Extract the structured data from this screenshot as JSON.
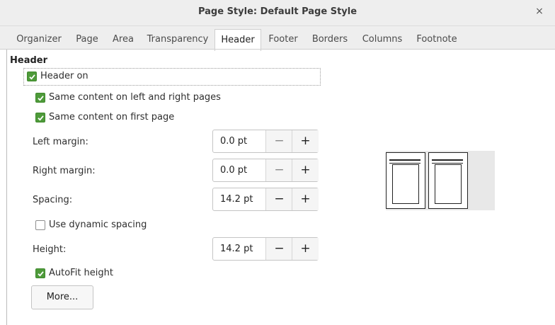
{
  "window": {
    "title": "Page Style: Default Page Style",
    "close_glyph": "×"
  },
  "tabs": [
    {
      "label": "Organizer"
    },
    {
      "label": "Page"
    },
    {
      "label": "Area"
    },
    {
      "label": "Transparency"
    },
    {
      "label": "Header",
      "active": true
    },
    {
      "label": "Footer"
    },
    {
      "label": "Borders"
    },
    {
      "label": "Columns"
    },
    {
      "label": "Footnote"
    }
  ],
  "header_section": {
    "title": "Header",
    "header_on": {
      "label": "Header on",
      "checked": true
    },
    "same_content_lr": {
      "label": "Same content on left and right pages",
      "checked": true
    },
    "same_content_first": {
      "label": "Same content on first page",
      "checked": true
    },
    "left_margin": {
      "label": "Left margin:",
      "value": "0.0 pt"
    },
    "right_margin": {
      "label": "Right margin:",
      "value": "0.0 pt"
    },
    "spacing": {
      "label": "Spacing:",
      "value": "14.2 pt"
    },
    "dynamic_spacing": {
      "label": "Use dynamic spacing",
      "checked": false
    },
    "height": {
      "label": "Height:",
      "value": "14.2 pt"
    },
    "autofit": {
      "label": "AutoFit height",
      "checked": true
    },
    "more_button": "More..."
  },
  "spin_glyphs": {
    "minus": "−",
    "plus": "+"
  },
  "colors": {
    "check_green": "#4e9a3a",
    "tab_bar": "#eeeeee"
  }
}
